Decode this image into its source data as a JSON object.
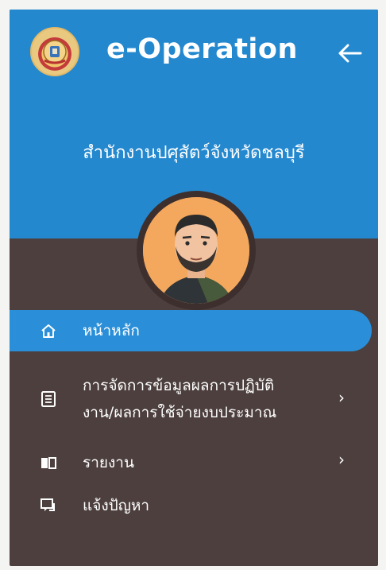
{
  "header": {
    "app_title": "e-Operation",
    "org_name": "สำนักงานปศุสัตว์จังหวัดชลบุรี"
  },
  "menu": {
    "items": [
      {
        "label": "หน้าหลัก",
        "icon": "home-icon",
        "active": true,
        "has_submenu": false
      },
      {
        "label_line1": "การจัดการข้อมูลผลการปฏิบัติ",
        "label_line2": "งาน/ผลการใช้จ่ายงบประมาณ",
        "icon": "list-icon",
        "active": false,
        "has_submenu": true
      },
      {
        "label": "รายงาน",
        "icon": "book-icon",
        "active": false,
        "has_submenu": true
      },
      {
        "label": "แจ้งปัญหา",
        "icon": "chat-icon",
        "active": false,
        "has_submenu": false
      }
    ],
    "chevron": "›"
  },
  "colors": {
    "header_blue": "#2488cf",
    "active_item": "#2a8fd8",
    "drawer_bg": "#4c3f3e"
  }
}
